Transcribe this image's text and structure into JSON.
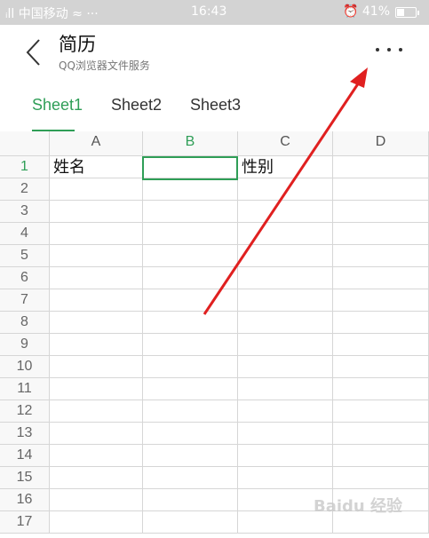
{
  "status_bar": {
    "left": "ᵢll 中国移动 ≈ ···",
    "time": "16:43",
    "right": "⏰ 41%",
    "battery_level": 0.41
  },
  "header": {
    "title": "简历",
    "subtitle": "QQ浏览器文件服务"
  },
  "tabs": [
    {
      "label": "Sheet1",
      "active": true
    },
    {
      "label": "Sheet2",
      "active": false
    },
    {
      "label": "Sheet3",
      "active": false
    }
  ],
  "sheet": {
    "columns": [
      "A",
      "B",
      "C",
      "D"
    ],
    "selected_column": "B",
    "rows": [
      "1",
      "2",
      "3",
      "4",
      "5",
      "6",
      "7",
      "8",
      "9",
      "10",
      "11",
      "12",
      "13",
      "14",
      "15",
      "16",
      "17"
    ],
    "selected_row": "1",
    "cells": {
      "A1": "姓名",
      "B1": "",
      "C1": "性别"
    }
  },
  "watermark": "Baidu 经验",
  "annotation_color": "#e02020"
}
